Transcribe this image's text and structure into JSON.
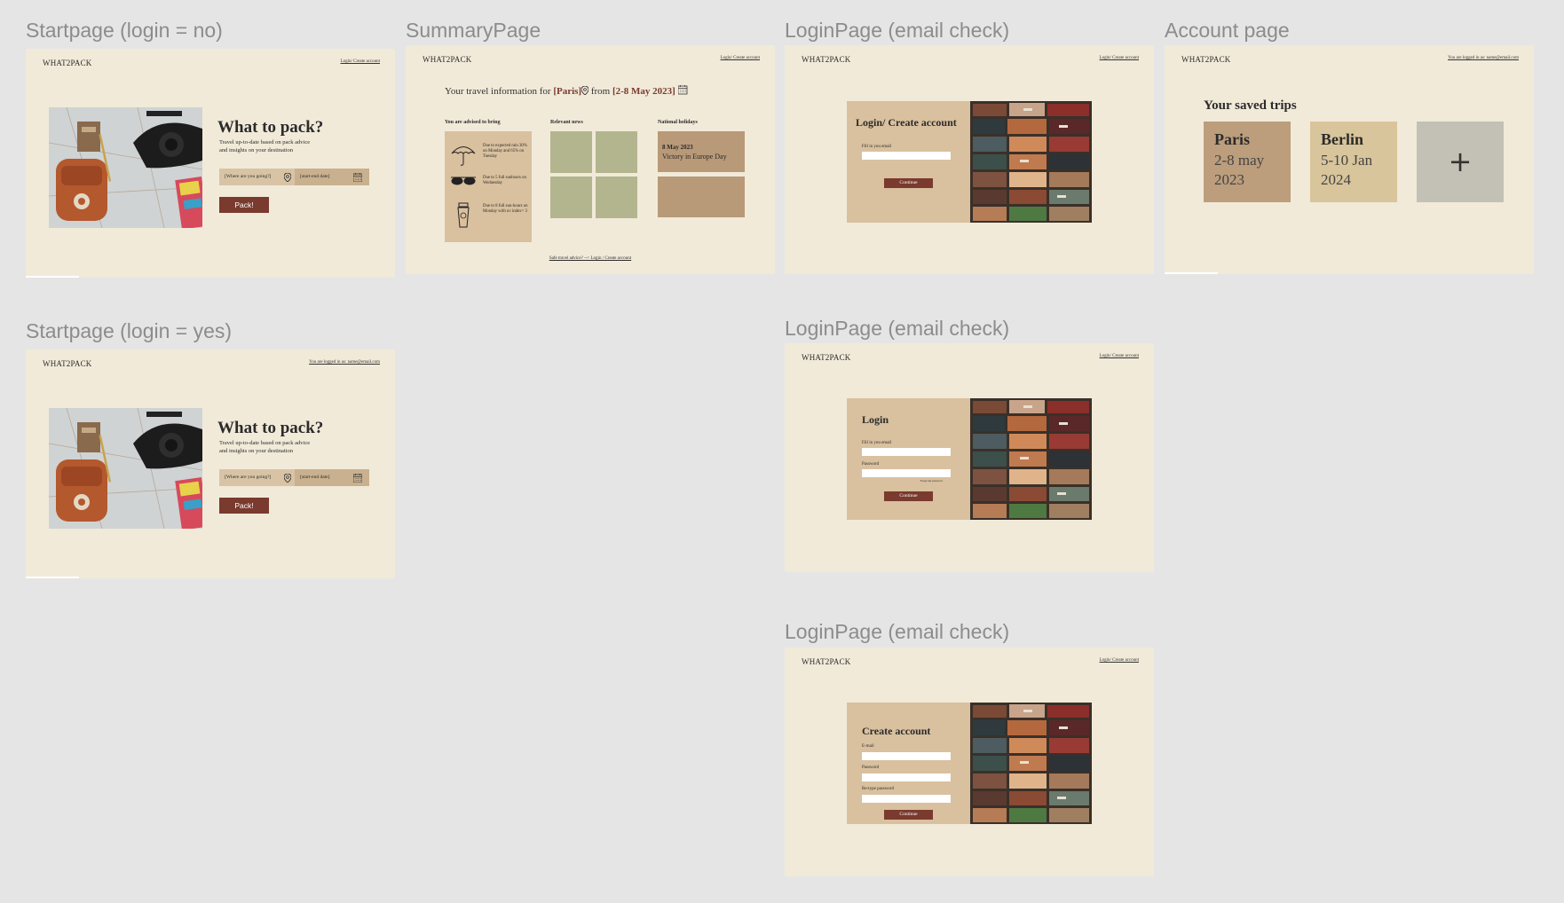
{
  "frames": {
    "start_no": {
      "title": "Startpage (login = no)",
      "brand": "WHAT2PACK",
      "toplink": "Login/ Create account",
      "heading": "What to pack?",
      "description": "Travel up-to-date based on pack advice and insights on your destination",
      "where_placeholder": "[Where are you going?]",
      "dates_placeholder": "[start-end date]",
      "button": "Pack!"
    },
    "summary": {
      "title": "SummaryPage",
      "brand": "WHAT2PACK",
      "toplink": "Login/ Create account",
      "head_prefix": "Your travel information for ",
      "head_city": "[Paris]",
      "head_from": " from ",
      "head_dates": "[2-8 May 2023]",
      "col_advice": "You are advised to bring",
      "col_news": "Relevant news",
      "col_holidays": "National holidays",
      "advice": [
        {
          "icon": "umbrella-icon",
          "text": "Due to expected rain 30% on Monday and 65% on Tuesday"
        },
        {
          "icon": "sunglasses-icon",
          "text": "Due to 5 full sunhours on Wednesday"
        },
        {
          "icon": "sunscreen-icon",
          "text": "Due to 8 full sun-hours on Monday with uv index= 3"
        }
      ],
      "holiday_date": "8 May 2023",
      "holiday_name": "Victory in Europe Day",
      "safe_link": "Safe travel advice? --> Login / Create account"
    },
    "login_check": {
      "title": "LoginPage (email check)",
      "brand": "WHAT2PACK",
      "toplink": "Login/ Create account",
      "heading": "Login/ Create account",
      "email_label": "Fill in you email",
      "button": "Continue"
    },
    "account": {
      "title": "Account page",
      "brand": "WHAT2PACK",
      "toplink": "You are logged in as: name@email.com",
      "heading": "Your saved trips",
      "trips": [
        {
          "city": "Paris",
          "dates": "2-8 may 2023",
          "color": "#bc9d7c"
        },
        {
          "city": "Berlin",
          "dates": "5-10 Jan 2024",
          "color": "#d9c59b"
        }
      ],
      "add_symbol": "+"
    },
    "start_yes": {
      "title": "Startpage (login = yes)",
      "brand": "WHAT2PACK",
      "toplink": "You are logged in as: name@email.com",
      "heading": "What to pack?",
      "description": "Travel up-to-date based on pack advice and insights on your destination",
      "where_placeholder": "[Where are you going?]",
      "dates_placeholder": "[start-end date]",
      "button": "Pack!"
    },
    "login_pw": {
      "title": "LoginPage (email check)",
      "brand": "WHAT2PACK",
      "toplink": "Login/ Create account",
      "heading": "Login",
      "email_label": "Fill in you email",
      "password_label": "Password",
      "forgot": "Forgot my password",
      "button": "Continue"
    },
    "create": {
      "title": "LoginPage (email check)",
      "brand": "WHAT2PACK",
      "toplink": "Login/ Create account",
      "heading": "Create account",
      "email_label": "E-mail",
      "password_label": "Password",
      "retype_label": "Re-type password",
      "button": "Continue"
    }
  },
  "colors": {
    "canvas": "#e5e5e5",
    "frame_bg": "#f1ead9",
    "accent": "#7a3a2e",
    "tan": "#d9c09e",
    "olive": "#b3b58e"
  }
}
